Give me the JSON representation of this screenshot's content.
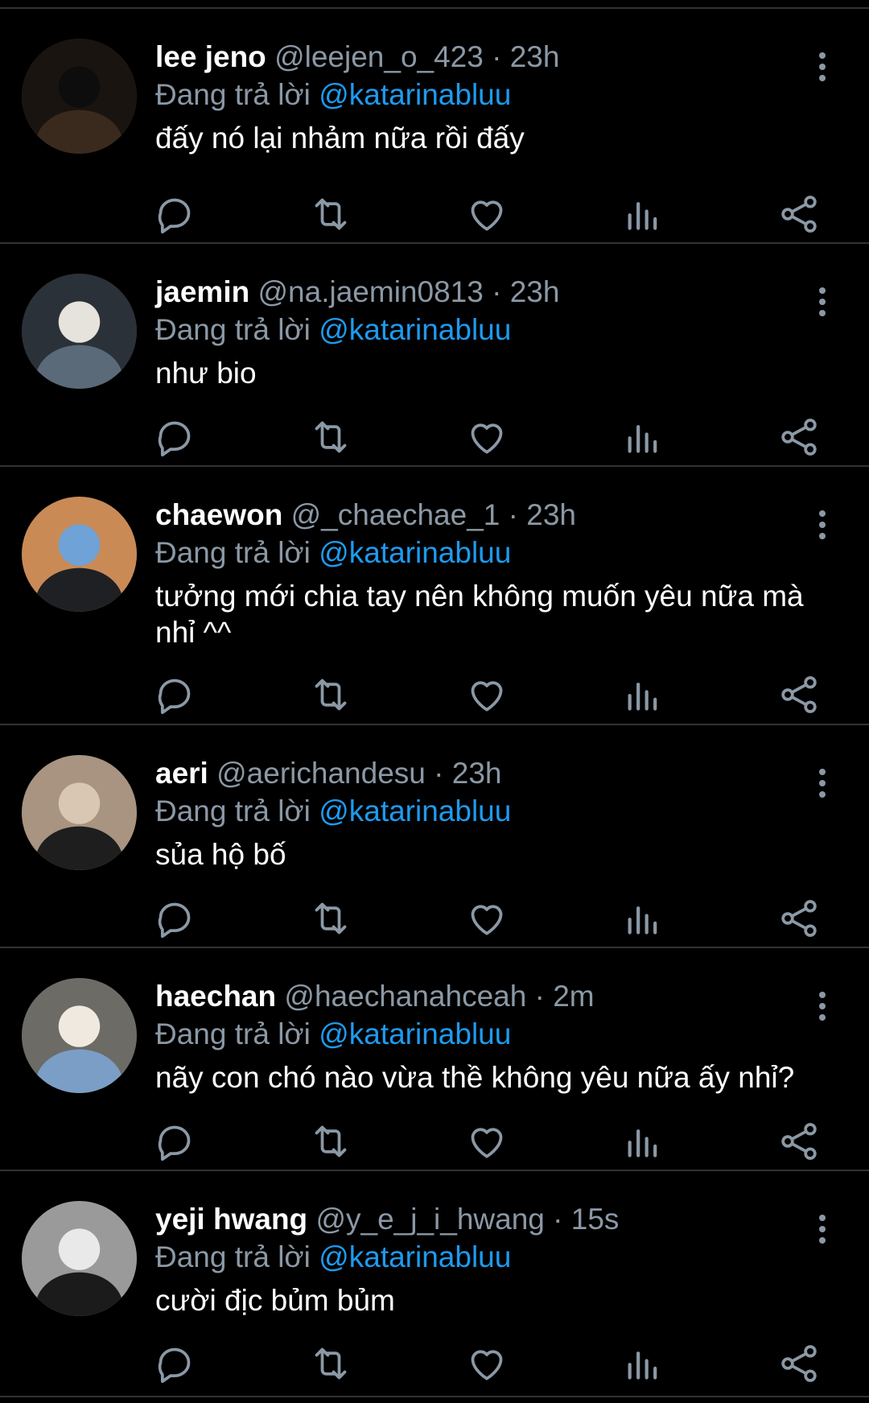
{
  "tweets": [
    {
      "name": "lee jeno",
      "handle": "@leejen_o_423",
      "time": "23h",
      "reply_prefix": "Đang trả lời",
      "reply_to": "@katarinabluu",
      "text": "đấy nó lại nhảm nữa rồi đấy",
      "avatar_colors": [
        "#1a1410",
        "#3a2a1e",
        "#0d0d0d"
      ]
    },
    {
      "name": "jaemin",
      "handle": "@na.jaemin0813",
      "time": "23h",
      "reply_prefix": "Đang trả lời",
      "reply_to": "@katarinabluu",
      "text": "như bio",
      "avatar_colors": [
        "#2b3138",
        "#5a6a78",
        "#e6e2dc"
      ]
    },
    {
      "name": "chaewon",
      "handle": "@_chaechae_1",
      "time": "23h",
      "reply_prefix": "Đang trả lời",
      "reply_to": "@katarinabluu",
      "text": "tưởng mới chia tay nên không muốn yêu nữa mà nhỉ ^^",
      "avatar_colors": [
        "#c98a56",
        "#1f2024",
        "#6fa2d6"
      ]
    },
    {
      "name": "aeri",
      "handle": "@aerichandesu",
      "time": "23h",
      "reply_prefix": "Đang trả lời",
      "reply_to": "@katarinabluu",
      "text": "sủa hộ bố",
      "avatar_colors": [
        "#a89480",
        "#1e1e1e",
        "#d9c7b4"
      ]
    },
    {
      "name": "haechan",
      "handle": "@haechanahceah",
      "time": "2m",
      "reply_prefix": "Đang trả lời",
      "reply_to": "@katarinabluu",
      "text": "nãy con chó nào vừa thề không yêu nữa ấy nhỉ?",
      "avatar_colors": [
        "#6c6b66",
        "#7b9ec6",
        "#efe9df"
      ]
    },
    {
      "name": "yeji hwang",
      "handle": "@y_e_j_i_hwang",
      "time": "15s",
      "reply_prefix": "Đang trả lời",
      "reply_to": "@katarinabluu",
      "text": "cười địc bủm bủm",
      "avatar_colors": [
        "#9a9a9a",
        "#1b1b1b",
        "#e9e9e9"
      ]
    }
  ],
  "separator": "·",
  "icons": {
    "reply": "reply-icon",
    "retweet": "retweet-icon",
    "like": "like-icon",
    "views": "views-icon",
    "share": "share-icon",
    "more": "more-vertical-icon"
  },
  "colors": {
    "background": "#000000",
    "text": "#ffffff",
    "secondary": "#8b98a5",
    "accent": "#1d9bf0",
    "divider": "#2f3336"
  }
}
